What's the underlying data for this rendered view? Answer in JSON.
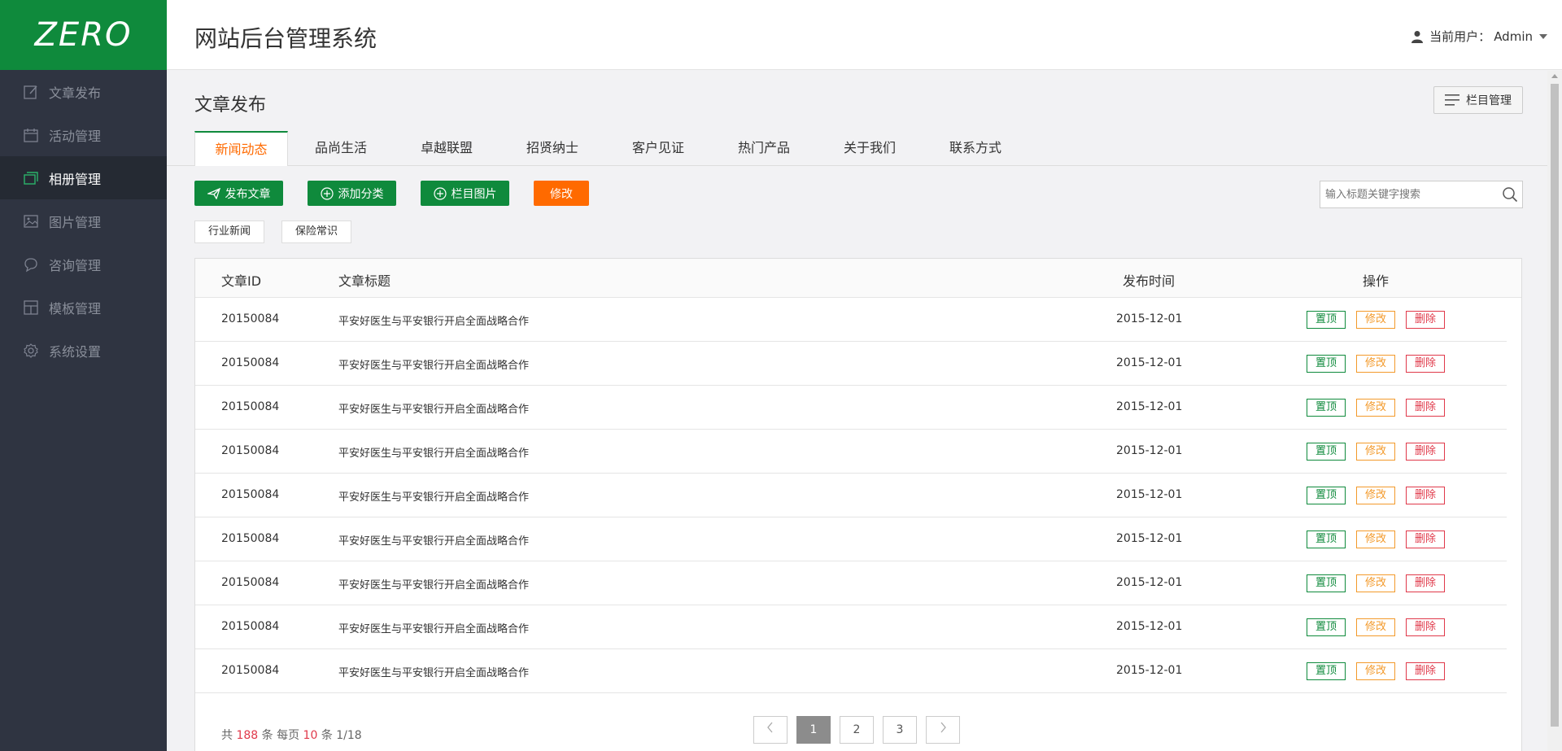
{
  "app": {
    "logo": "ZERO",
    "title": "网站后台管理系统",
    "user_label": "当前用户：",
    "user_name": "Admin"
  },
  "sidebar": {
    "items": [
      {
        "label": "文章发布",
        "icon": "edit-icon",
        "active": false
      },
      {
        "label": "活动管理",
        "icon": "calendar-icon",
        "active": false
      },
      {
        "label": "相册管理",
        "icon": "album-icon",
        "active": true
      },
      {
        "label": "图片管理",
        "icon": "image-icon",
        "active": false
      },
      {
        "label": "咨询管理",
        "icon": "chat-icon",
        "active": false
      },
      {
        "label": "模板管理",
        "icon": "template-icon",
        "active": false
      },
      {
        "label": "系统设置",
        "icon": "gear-icon",
        "active": false
      }
    ]
  },
  "page": {
    "title": "文章发布",
    "column_manage": "栏目管理"
  },
  "tabs": [
    "新闻动态",
    "品尚生活",
    "卓越联盟",
    "招贤纳士",
    "客户见证",
    "热门产品",
    "关于我们",
    "联系方式"
  ],
  "toolbar": {
    "publish": "发布文章",
    "add_category": "添加分类",
    "column_image": "栏目图片",
    "modify": "修改",
    "search_placeholder": "输入标题关键字搜索"
  },
  "categories": [
    "行业新闻",
    "保险常识"
  ],
  "table": {
    "headers": {
      "id": "文章ID",
      "title": "文章标题",
      "date": "发布时间",
      "ops": "操作"
    },
    "actions": {
      "top": "置顶",
      "edit": "修改",
      "del": "删除"
    },
    "rows": [
      {
        "id": "20150084",
        "title": "平安好医生与平安银行开启全面战略合作",
        "date": "2015-12-01"
      },
      {
        "id": "20150084",
        "title": "平安好医生与平安银行开启全面战略合作",
        "date": "2015-12-01"
      },
      {
        "id": "20150084",
        "title": "平安好医生与平安银行开启全面战略合作",
        "date": "2015-12-01"
      },
      {
        "id": "20150084",
        "title": "平安好医生与平安银行开启全面战略合作",
        "date": "2015-12-01"
      },
      {
        "id": "20150084",
        "title": "平安好医生与平安银行开启全面战略合作",
        "date": "2015-12-01"
      },
      {
        "id": "20150084",
        "title": "平安好医生与平安银行开启全面战略合作",
        "date": "2015-12-01"
      },
      {
        "id": "20150084",
        "title": "平安好医生与平安银行开启全面战略合作",
        "date": "2015-12-01"
      },
      {
        "id": "20150084",
        "title": "平安好医生与平安银行开启全面战略合作",
        "date": "2015-12-01"
      },
      {
        "id": "20150084",
        "title": "平安好医生与平安银行开启全面战略合作",
        "date": "2015-12-01"
      }
    ]
  },
  "pagination": {
    "total_prefix": "共",
    "total": "188",
    "per_page_prefix": "条 每页",
    "per_page": "10",
    "page_suffix": "条 1/18",
    "pages": [
      "1",
      "2",
      "3"
    ],
    "current": "1"
  },
  "colors": {
    "brand": "#0f8a3c",
    "accent": "#ff6a00",
    "sidebar": "#2f3441",
    "danger": "#e0394a"
  }
}
